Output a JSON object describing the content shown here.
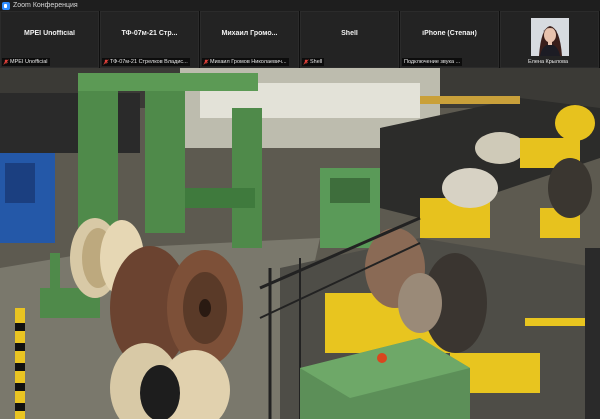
{
  "window": {
    "title": "Zoom Конференция"
  },
  "participants": [
    {
      "display": "MPEI Unofficial",
      "label": "MPEI Unofficial",
      "muted": true
    },
    {
      "display": "ТФ-07м-21  Стр...",
      "label": "ТФ-07м-21 Стрелков Владис...",
      "muted": true
    },
    {
      "display": "Михаил  Громо...",
      "label": "Михаил Громов Николаевич...",
      "muted": true
    },
    {
      "display": "Shell",
      "label": "Shell",
      "muted": true
    },
    {
      "display": "iPhone (Степан)",
      "label": "Подключение звука ...",
      "muted": false
    },
    {
      "display": "",
      "label": "Елена Крылова",
      "muted": false,
      "has_video": true
    }
  ],
  "colors": {
    "accent": "#2d8cff",
    "mute": "#e0403a",
    "tile_bg": "#232323"
  }
}
